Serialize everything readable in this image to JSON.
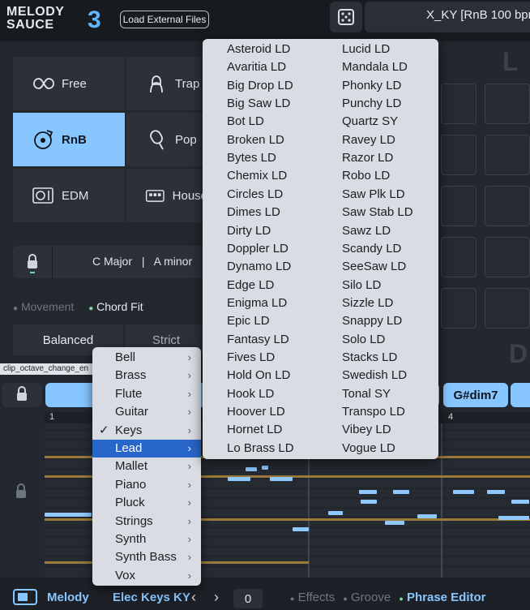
{
  "header": {
    "logo_line1": "MELODY",
    "logo_line2": "SAUCE",
    "logo_version": "3",
    "load_button": "Load External Files",
    "preset_name": "X_KY  [RnB 100 bpm"
  },
  "genres": [
    {
      "label": "Free",
      "icon": "infinity-icon",
      "active": false
    },
    {
      "label": "Trap",
      "icon": "hooded-figure-icon",
      "active": false
    },
    {
      "label": "RnB",
      "icon": "vinyl-icon",
      "active": true
    },
    {
      "label": "Pop",
      "icon": "popsicle-icon",
      "active": false
    },
    {
      "label": "EDM",
      "icon": "turntable-icon",
      "active": false
    },
    {
      "label": "House",
      "icon": "drum-machine-icon",
      "active": false
    }
  ],
  "key": {
    "major": "C Major",
    "separator": "|",
    "minor": "A minor"
  },
  "mode_tabs": {
    "movement": "Movement",
    "chord_fit": "Chord Fit"
  },
  "segments": {
    "balanced": "Balanced",
    "strict": "Strict"
  },
  "clip_tooltip": "clip_octave_change_en",
  "chords": {
    "chip": "G#dim7"
  },
  "ruler": {
    "bar1": "1",
    "bar4": "4"
  },
  "bottom": {
    "track": "Melody",
    "instrument": "Elec Keys KY",
    "prev": "‹",
    "next": "›",
    "octave": "0",
    "tab_effects": "Effects",
    "tab_groove": "Groove",
    "tab_phrase": "Phrase Editor"
  },
  "category_menu": {
    "items": [
      "Bell",
      "Brass",
      "Flute",
      "Guitar",
      "Keys",
      "Lead",
      "Mallet",
      "Piano",
      "Pluck",
      "Strings",
      "Synth",
      "Synth Bass",
      "Vox"
    ],
    "checked": "Keys",
    "highlighted": "Lead",
    "check_mark": "✓",
    "chevron": "›"
  },
  "lead_menu": {
    "col1": [
      "Asteroid LD",
      "Avaritia LD",
      "Big Drop LD",
      "Big Saw LD",
      "Bot LD",
      "Broken LD",
      "Bytes LD",
      "Chemix LD",
      "Circles LD",
      "Dimes LD",
      "Dirty LD",
      "Doppler LD",
      "Dynamo LD",
      "Edge LD",
      "Enigma LD",
      "Epic LD",
      "Fantasy LD",
      "Fives LD",
      "Hold On LD",
      "Hook LD",
      "Hoover LD",
      "Hornet LD",
      "Lo Brass LD"
    ],
    "col2": [
      "Lucid LD",
      "Mandala LD",
      "Phonky LD",
      "Punchy LD",
      "Quartz SY",
      "Ravey LD",
      "Razor LD",
      "Robo LD",
      "Saw Plk LD",
      "Saw Stab LD",
      "Sawz LD",
      "Scandy LD",
      "SeeSaw LD",
      "Silo LD",
      "Sizzle LD",
      "Snappy LD",
      "Solo LD",
      "Stacks LD",
      "Swedish LD",
      "Tonal SY",
      "Transpo LD",
      "Vibey LD",
      "Vogue LD"
    ]
  },
  "colors": {
    "accent": "#87c6ff",
    "highlight": "#2866c9",
    "note": "#8fc9ff",
    "gold_line": "#9a7a3a"
  }
}
